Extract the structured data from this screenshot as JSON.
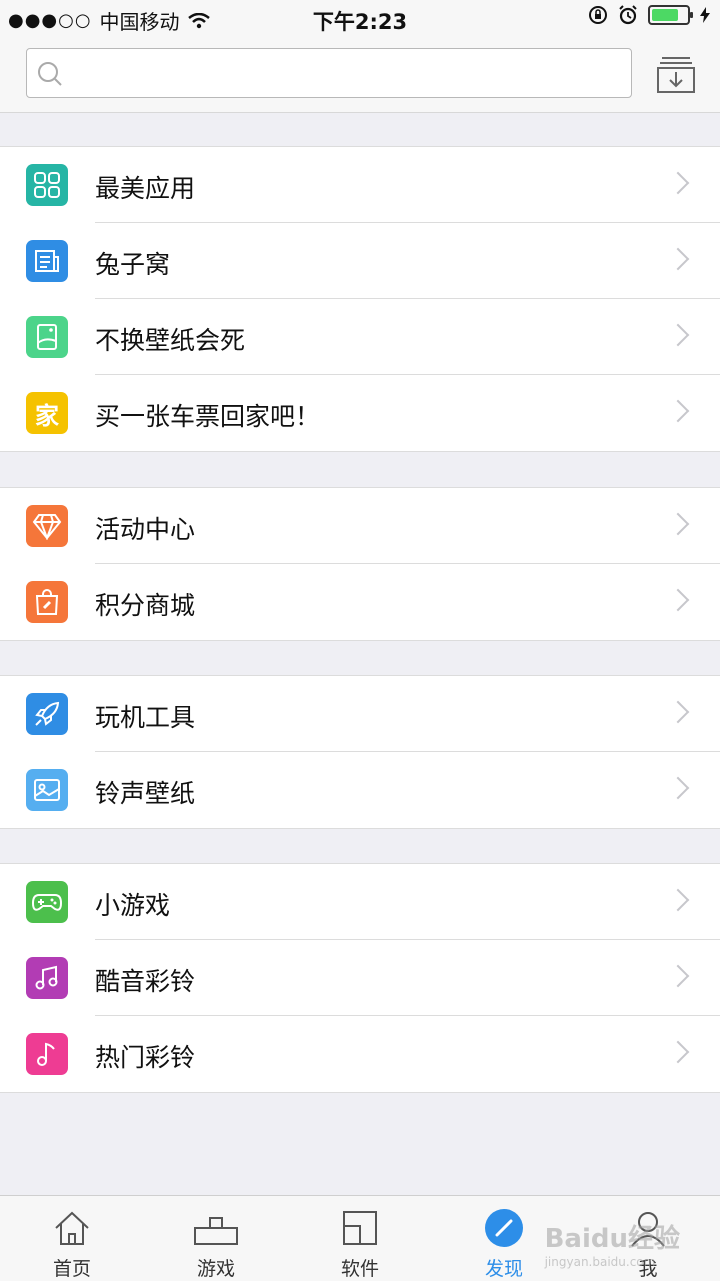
{
  "status": {
    "carrier": "中国移动",
    "time": "下午2:23",
    "battery_level": 0.75
  },
  "search": {
    "placeholder": ""
  },
  "groups": [
    [
      {
        "label": "最美应用",
        "color": "#26b5a5",
        "icon": "grid-icon"
      },
      {
        "label": "兔子窝",
        "color": "#2f8de4",
        "icon": "newspaper-icon"
      },
      {
        "label": "不换壁纸会死",
        "color": "#4cd48a",
        "icon": "phone-picture-icon"
      },
      {
        "label": "买一张车票回家吧！",
        "color": "#f5c200",
        "icon": "home-character-icon",
        "glyph": "家"
      }
    ],
    [
      {
        "label": "活动中心",
        "color": "#f5763a",
        "icon": "diamond-icon"
      },
      {
        "label": "积分商城",
        "color": "#f5763a",
        "icon": "shopping-bag-icon"
      }
    ],
    [
      {
        "label": "玩机工具",
        "color": "#2f8de4",
        "icon": "rocket-icon"
      },
      {
        "label": "铃声壁纸",
        "color": "#55aef0",
        "icon": "image-icon"
      }
    ],
    [
      {
        "label": "小游戏",
        "color": "#4cbf4c",
        "icon": "gamepad-icon"
      },
      {
        "label": "酷音彩铃",
        "color": "#b23cb4",
        "icon": "music-note-icon"
      },
      {
        "label": "热门彩铃",
        "color": "#ee3c93",
        "icon": "single-note-icon"
      }
    ]
  ],
  "tabs": [
    {
      "label": "首页",
      "icon": "home-icon",
      "active": false
    },
    {
      "label": "游戏",
      "icon": "game-icon",
      "active": false
    },
    {
      "label": "软件",
      "icon": "apps-icon",
      "active": false
    },
    {
      "label": "发现",
      "icon": "compass-icon",
      "active": true
    },
    {
      "label": "我",
      "icon": "user-icon",
      "active": false
    }
  ],
  "watermark": {
    "main": "Baidu经验",
    "sub": "jingyan.baidu.com"
  }
}
